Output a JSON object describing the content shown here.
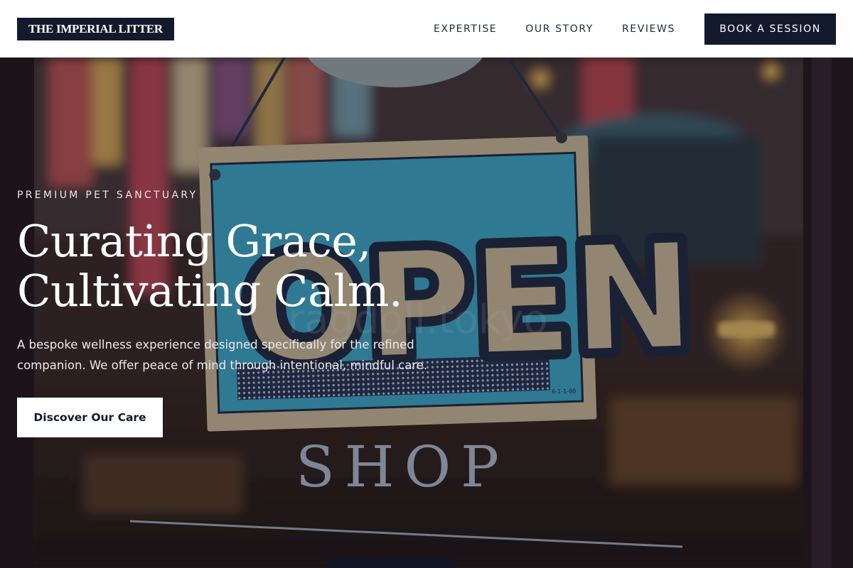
{
  "header": {
    "logo": "THE IMPERIAL LITTER",
    "nav": [
      "EXPERTISE",
      "OUR STORY",
      "REVIEWS"
    ],
    "book_button": "BOOK A SESSION"
  },
  "hero": {
    "eyebrow": "PREMIUM PET SANCTUARY",
    "headline_line1": "Curating Grace,",
    "headline_line2": "Cultivating Calm.",
    "subtext": "A bespoke wellness experience designed specifically for the refined companion. We offer peace of mind through intentional, mindful care.",
    "cta": "Discover Our Care",
    "background": {
      "sign_text": "OPEN",
      "door_text": "SHOP",
      "watermark": "ragdoll.tokyo"
    }
  },
  "colors": {
    "navy": "#121a2c",
    "white": "#ffffff",
    "sign_blue": "#3fb3d6",
    "sign_kraft": "#d8c7a3"
  }
}
